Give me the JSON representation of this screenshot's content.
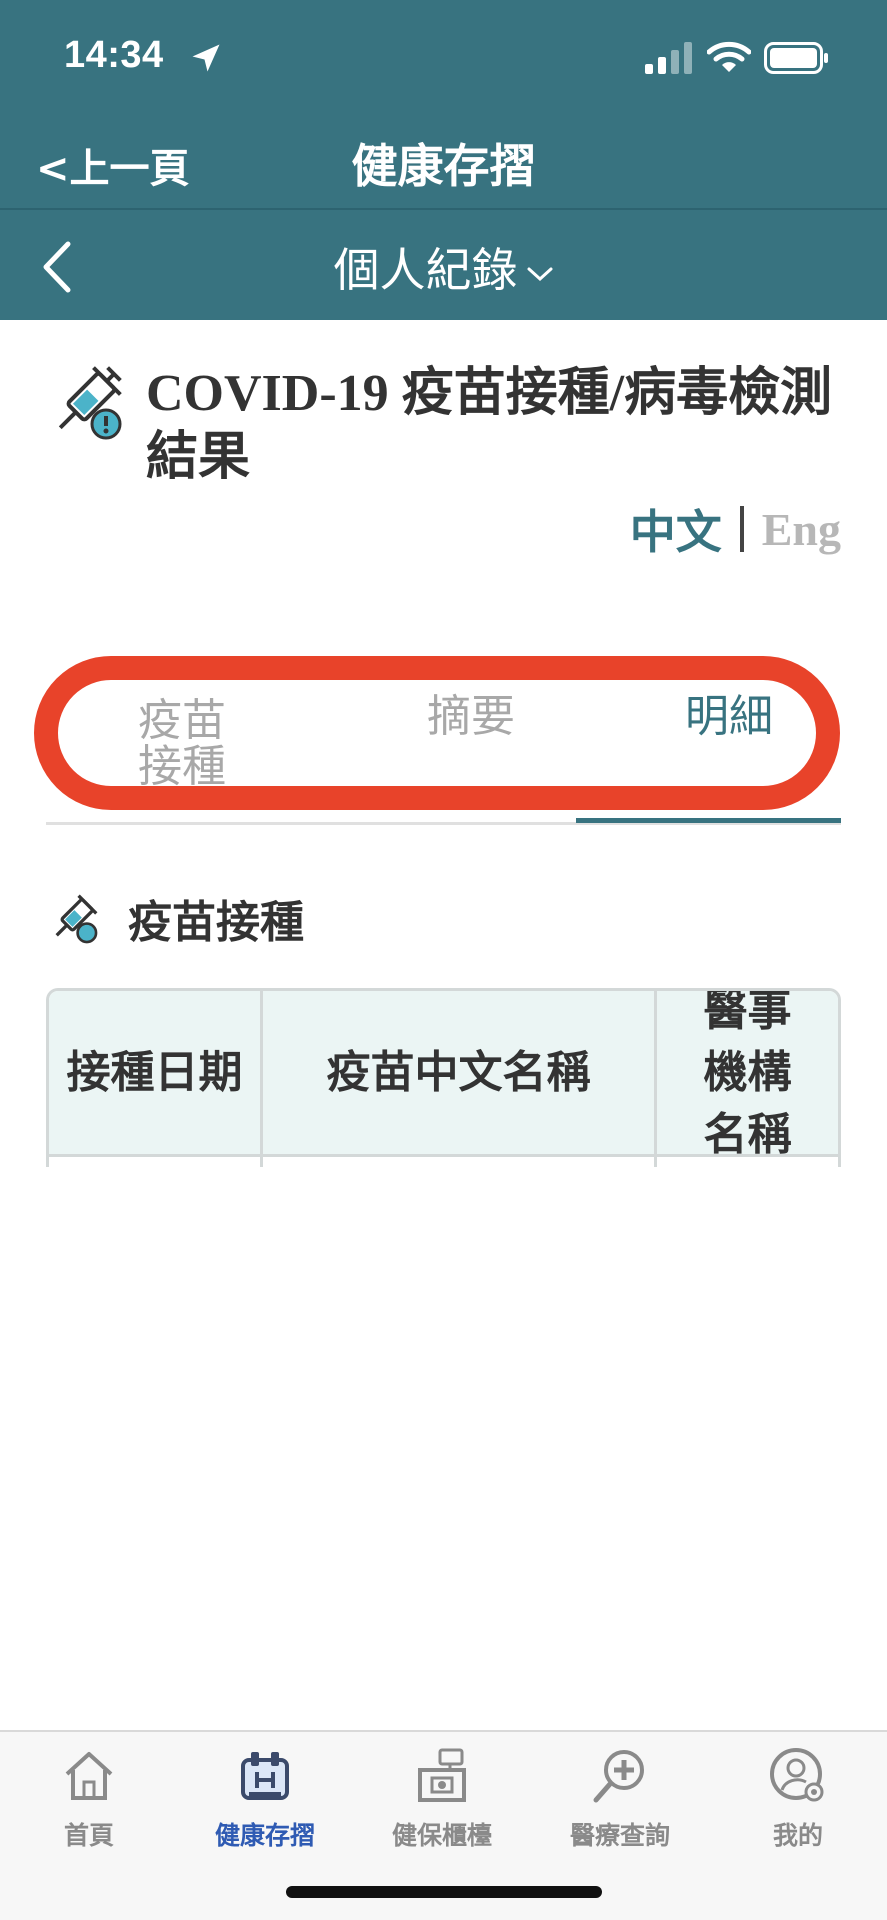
{
  "status_bar": {
    "time": "14:34"
  },
  "header": {
    "back_label": "<上一頁",
    "title": "健康存摺"
  },
  "subnav": {
    "title": "個人紀錄"
  },
  "page": {
    "title": "COVID-19 疫苗接種/病毒檢測結果"
  },
  "language": {
    "zh": "中文",
    "en": "Eng"
  },
  "tabs": [
    {
      "label": "疫苗接種",
      "active": false
    },
    {
      "label": "摘要",
      "active": false
    },
    {
      "label": "明細",
      "active": true
    }
  ],
  "section": {
    "title": "疫苗接種"
  },
  "table": {
    "headers": [
      "接種日期",
      "疫苗中文名稱",
      "醫事機構名稱"
    ]
  },
  "bottom_nav": [
    {
      "label": "首頁",
      "icon": "home-icon",
      "active": false
    },
    {
      "label": "健康存摺",
      "icon": "health-passbook-icon",
      "active": true
    },
    {
      "label": "健保櫃檯",
      "icon": "counter-icon",
      "active": false
    },
    {
      "label": "醫療查詢",
      "icon": "medical-search-icon",
      "active": false
    },
    {
      "label": "我的",
      "icon": "profile-settings-icon",
      "active": false
    }
  ],
  "colors": {
    "header": "#387380",
    "accent": "#387380",
    "highlight": "#e8432a",
    "nav_active": "#2f5bb3"
  }
}
